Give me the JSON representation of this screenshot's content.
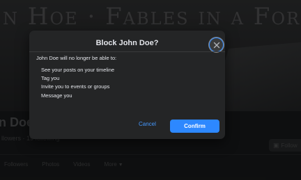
{
  "background": {
    "cover_text": "n Hoe · Fables in a Foreign Land",
    "profile_name": "n Doe",
    "profile_meta": "llowers · 19 following",
    "follow_label": "Follow",
    "tabs": [
      "Followers",
      "Photos",
      "Videos",
      "More"
    ]
  },
  "dialog": {
    "title": "Block John Doe?",
    "intro": "John Doe will no longer be able to:",
    "consequences": [
      "See your posts on your timeline",
      "Tag you",
      "Invite you to events or groups",
      "Message you"
    ],
    "cancel_label": "Cancel",
    "confirm_label": "Confirm"
  },
  "icons": {
    "close": "close-icon",
    "follow": "plus-icon",
    "more": "chevron-down-icon"
  },
  "colors": {
    "accent": "#2d88ff",
    "link": "#4599ff",
    "dialog_bg": "#242526",
    "page_bg": "#161718"
  }
}
